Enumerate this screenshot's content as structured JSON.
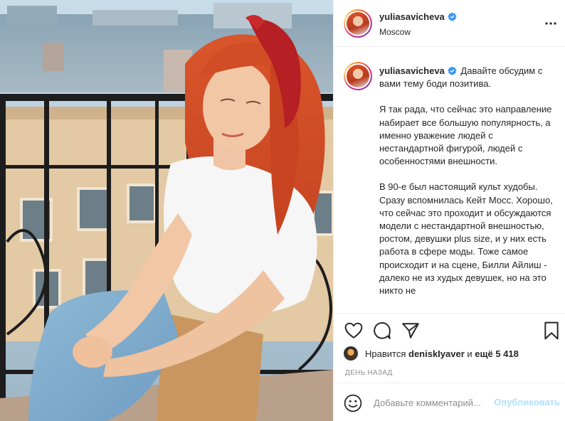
{
  "post": {
    "username": "yuliasavicheva",
    "location": "Moscow",
    "verified": true
  },
  "caption": {
    "intro": "Давайте обсудим с вами тему боди позитива.",
    "paragraphs": [
      "Я так рада, что сейчас это направление набирает все большую популярность, а именно уважение людей с нестандартной фигурой, людей с особенностями внешности.",
      "В 90-е был настоящий культ худобы. Сразу вспомнилась Кейт Мосс. Хорошо, что сейчас это проходит и обсуждаются модели с нестандартной внешностью, ростом, девушки plus size, и у них есть работа в сфере моды. Тоже самое происходит и на сцене, Билли Айлиш - далеко не из худых девушек, но на это никто не"
    ]
  },
  "likes": {
    "prefix": "Нравится",
    "user": "deniskIyaver",
    "joiner": "и",
    "others": "ещё 5 418"
  },
  "time": "ДЕНЬ НАЗАД",
  "comment": {
    "placeholder": "Добавьте комментарий...",
    "publish_label": "Опубликовать"
  },
  "icons": {
    "more": "more-icon",
    "like": "heart-icon",
    "comment": "comment-icon",
    "share": "paper-plane-icon",
    "save": "bookmark-icon",
    "emoji": "smiley-icon",
    "verified": "verified-badge-icon"
  },
  "colors": {
    "verified": "#3897f0",
    "publish_disabled": "#b2dffc",
    "muted": "#8e8e8e",
    "border": "#efefef"
  }
}
